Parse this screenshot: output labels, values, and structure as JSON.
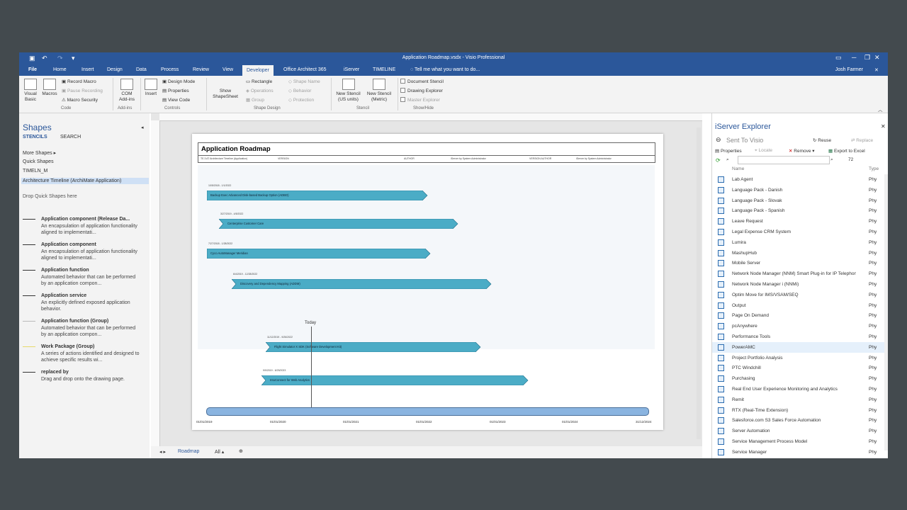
{
  "window": {
    "title": "Application Roadmap.vsdx - Visio Professional",
    "user": "Josh Farmer"
  },
  "tabs": [
    "File",
    "Home",
    "Insert",
    "Design",
    "Data",
    "Process",
    "Review",
    "View",
    "Developer",
    "Office Architect 365",
    "iServer",
    "TIMELINE"
  ],
  "tell_me": "Tell me what you want to do...",
  "ribbon": {
    "visual_basic": "Visual Basic",
    "macros": "Macros",
    "record_macro": "Record Macro",
    "pause_recording": "Pause Recording",
    "macro_security": "Macro Security",
    "com_addins": "COM Add-ins",
    "insert": "Insert",
    "design_mode": "Design Mode",
    "properties": "Properties",
    "view_code": "View Code",
    "show_shapesheet": "Show ShapeSheet",
    "rectangle": "Rectangle",
    "operations": "Operations",
    "group": "Group",
    "shape_name": "Shape Name",
    "behavior": "Behavior",
    "protection": "Protection",
    "new_stencil_us": "New Stencil (US units)",
    "new_stencil_metric": "New Stencil (Metric)",
    "document_stencil": "Document Stencil",
    "drawing_explorer": "Drawing Explorer",
    "master_explorer": "Master Explorer",
    "groups": [
      "Code",
      "Add-ins",
      "Controls",
      "Shape Design",
      "Stencil",
      "Show/Hide"
    ]
  },
  "shapes_pane": {
    "title": "Shapes",
    "tab_stencils": "STENCILS",
    "tab_search": "SEARCH",
    "items": [
      "More Shapes",
      "Quick Shapes",
      "TIMELN_M",
      "Architecture Timeline (ArchiMate Application)"
    ],
    "drop_hint": "Drop Quick Shapes here",
    "stencils": [
      {
        "name": "Application component (Release Da...",
        "desc": "An encapsulation of application functionality aligned to implementati..."
      },
      {
        "name": "Application component",
        "desc": "An encapsulation of application functionality aligned to implementati..."
      },
      {
        "name": "Application function",
        "desc": "Automated behavior that can be performed by an application compon..."
      },
      {
        "name": "Application service",
        "desc": "An explicitly defined exposed application behavior."
      },
      {
        "name": "Application function (Group)",
        "desc": "Automated behavior that can be performed by an application compon..."
      },
      {
        "name": "Work Package (Group)",
        "desc": "A series of actions identified and designed to achieve specific results wi..."
      },
      {
        "name": "replaced by",
        "desc": "Drag and drop onto the drawing page."
      }
    ]
  },
  "diagram": {
    "title": "Application Roadmap",
    "meta": [
      "TE.3 AT Architecture Timeline (Application)",
      "VERSION",
      "AUTHOR",
      "iServer by System Administrator",
      "VERSION AUTHOR",
      "iServer by System Administrator"
    ],
    "today_label": "Today",
    "bars": [
      {
        "label": "Backup Exec Advanced Disk-based Backup Option (ADBO)",
        "date": "10/5/2018 - 1/1/2022"
      },
      {
        "label": "Centerprise Customer Care",
        "date": "3/27/2019 - 4/5/2022"
      },
      {
        "label": "Cyco AutoManager Meridian",
        "date": "7/27/2018 - 1/28/2022"
      },
      {
        "label": "Discovery and Dependency Mapping (ADDM)",
        "date": "6/4/2019 - 12/28/2022"
      },
      {
        "label": "Flight Simulator X SDK (Software Development Kit)",
        "date": "11/12/2019 - 9/26/2022"
      },
      {
        "label": "IntuConnect for Web Analytics",
        "date": "9/9/2019 - 6/25/2023"
      }
    ],
    "axis_dates": [
      "01/01/2019",
      "01/01/2020",
      "01/01/2021",
      "01/01/2022",
      "01/01/2023",
      "01/01/2024",
      "31/12/2024"
    ]
  },
  "page_tabs": {
    "current": "Roadmap",
    "all": "All"
  },
  "iserver": {
    "title": "iServer Explorer",
    "sent": "Sent To Visio",
    "reuse": "Reuse",
    "replace": "Replace",
    "properties": "Properties",
    "locate": "Locate",
    "remove": "Remove",
    "export": "Export to Excel",
    "count": "72",
    "col_name": "Name",
    "col_type": "Type",
    "items": [
      {
        "name": "Lab Agent",
        "type": "Phy"
      },
      {
        "name": "Language Pack - Danish",
        "type": "Phy"
      },
      {
        "name": "Language Pack - Slovak",
        "type": "Phy"
      },
      {
        "name": "Language Pack - Spanish",
        "type": "Phy"
      },
      {
        "name": "Leave Request",
        "type": "Phy"
      },
      {
        "name": "Legal Expense CRM System",
        "type": "Phy"
      },
      {
        "name": "Lumira",
        "type": "Phy"
      },
      {
        "name": "MashupHub",
        "type": "Phy"
      },
      {
        "name": "Mobile Server",
        "type": "Phy"
      },
      {
        "name": "Network Node Manager (NNM) Smart Plug-in for IP Telephony",
        "type": "Phy"
      },
      {
        "name": "Network Node Manager i (NNMi)",
        "type": "Phy"
      },
      {
        "name": "Optim Move for IMS/VSAM/SEQ",
        "type": "Phy"
      },
      {
        "name": "Output",
        "type": "Phy"
      },
      {
        "name": "Page On Demand",
        "type": "Phy"
      },
      {
        "name": "pcAnywhere",
        "type": "Phy"
      },
      {
        "name": "Performance Tools",
        "type": "Phy"
      },
      {
        "name": "PowerAMC",
        "type": "Phy"
      },
      {
        "name": "Project Portfolio Analysis",
        "type": "Phy"
      },
      {
        "name": "PTC Windchill",
        "type": "Phy"
      },
      {
        "name": "Purchasing",
        "type": "Phy"
      },
      {
        "name": "Real End User Experience Monitoring and Analytics",
        "type": "Phy"
      },
      {
        "name": "Remit",
        "type": "Phy"
      },
      {
        "name": "RTX (Real-Time Extension)",
        "type": "Phy"
      },
      {
        "name": "Salesforce.com S3 Sales Force Automation",
        "type": "Phy"
      },
      {
        "name": "Server Automation",
        "type": "Phy"
      },
      {
        "name": "Service Management Process Model",
        "type": "Phy"
      },
      {
        "name": "Service Manager",
        "type": "Phy"
      }
    ]
  }
}
